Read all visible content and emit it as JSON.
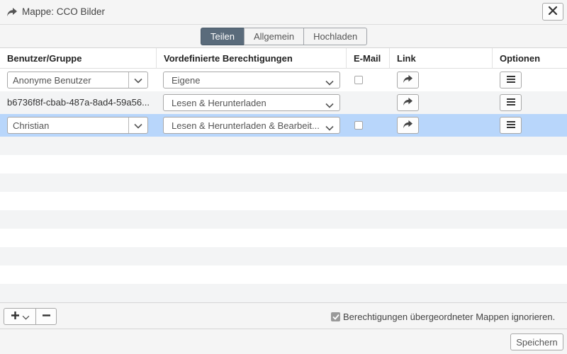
{
  "window": {
    "title": "Mappe: CCO Bilder",
    "title_icon": "share-arrow-icon",
    "close_icon": "close-icon"
  },
  "tabs": [
    {
      "label": "Teilen",
      "active": true
    },
    {
      "label": "Allgemein",
      "active": false
    },
    {
      "label": "Hochladen",
      "active": false
    }
  ],
  "table": {
    "columns": [
      "Benutzer/Gruppe",
      "Vordefinierte Berechtigungen",
      "E-Mail",
      "Link",
      "Optionen"
    ],
    "rows": [
      {
        "user": "Anonyme Benutzer",
        "user_editable": true,
        "permission": "Eigene",
        "email_checkbox": true,
        "email_checked": false,
        "selected": false
      },
      {
        "user": "b6736f8f-cbab-487a-8ad4-59a56...",
        "user_editable": false,
        "permission": "Lesen & Herunterladen",
        "email_checkbox": false,
        "email_checked": false,
        "selected": false
      },
      {
        "user": "Christian",
        "user_editable": true,
        "permission": "Lesen & Herunterladen & Bearbeit...",
        "email_checkbox": true,
        "email_checked": false,
        "selected": true
      }
    ],
    "link_icon": "share-arrow-icon",
    "options_icon": "menu-lines-icon"
  },
  "footer": {
    "add_icon": "plus-icon",
    "add_dropdown_icon": "chevron-down-icon",
    "remove_icon": "minus-icon",
    "ignore_parent_label": "Berechtigungen übergeordneter Mappen ignorieren.",
    "ignore_parent_checked": true,
    "save_label": "Speichern"
  },
  "colors": {
    "active_tab": "#5a6b7b",
    "selected_row": "#b8d6fb",
    "stripe": "#f3f4f5"
  }
}
